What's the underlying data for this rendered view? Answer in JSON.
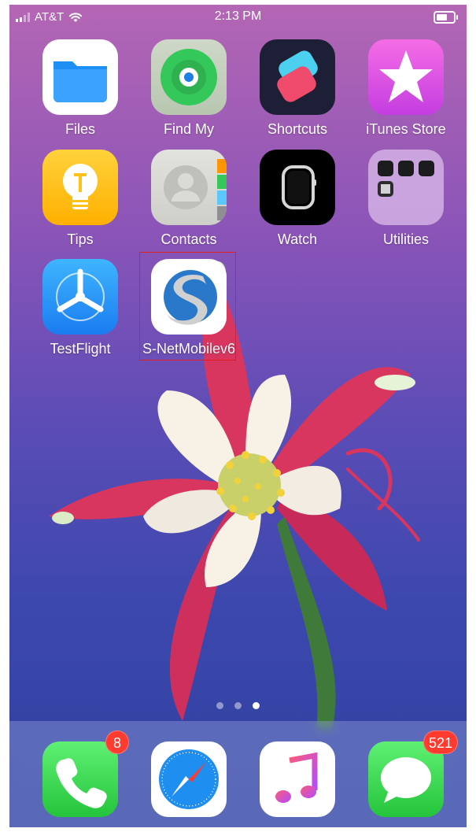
{
  "status_bar": {
    "carrier": "AT&T",
    "time": "2:13 PM"
  },
  "apps": [
    {
      "name": "Files"
    },
    {
      "name": "Find My"
    },
    {
      "name": "Shortcuts"
    },
    {
      "name": "iTunes Store"
    },
    {
      "name": "Tips"
    },
    {
      "name": "Contacts"
    },
    {
      "name": "Watch"
    },
    {
      "name": "Utilities"
    },
    {
      "name": "TestFlight"
    },
    {
      "name": "S-NetMobilev6"
    }
  ],
  "page_indicator": {
    "pages": 3,
    "current": 3
  },
  "dock": {
    "phone_badge": "8",
    "messages_badge": "521"
  },
  "colors": {
    "badge": "#ff3b30",
    "highlight_box": "#e02020"
  }
}
